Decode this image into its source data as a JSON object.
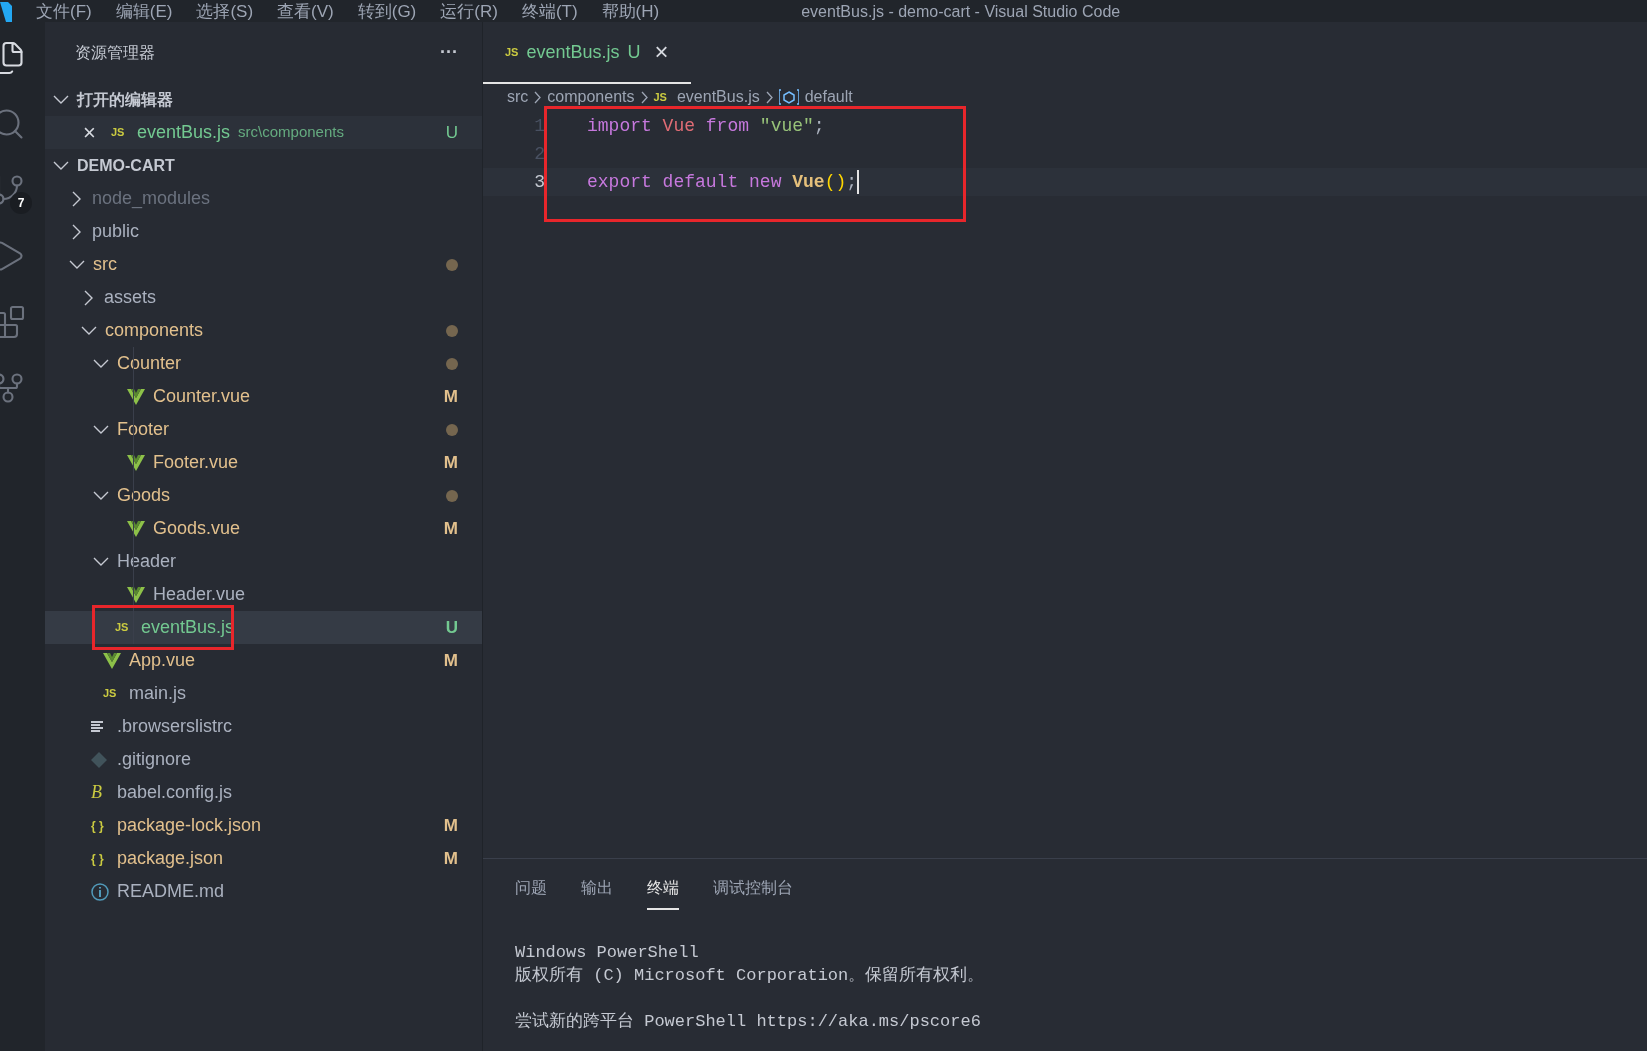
{
  "menu": [
    "文件(F)",
    "编辑(E)",
    "选择(S)",
    "查看(V)",
    "转到(G)",
    "运行(R)",
    "终端(T)",
    "帮助(H)"
  ],
  "window": {
    "title": "eventBus.js - demo-cart - Visual Studio Code"
  },
  "activity_bar": [
    {
      "kind": "files",
      "selected": true
    },
    {
      "kind": "search",
      "selected": false
    },
    {
      "kind": "source-control",
      "selected": false,
      "badge": "7"
    },
    {
      "kind": "run",
      "selected": false
    },
    {
      "kind": "extensions",
      "selected": false
    },
    {
      "kind": "graph",
      "selected": false
    }
  ],
  "sidebar": {
    "title": "资源管理器",
    "more": "···",
    "open_editors": {
      "title": "打开的编辑器",
      "expanded": true,
      "items": [
        {
          "close": "×",
          "icon_label": "JS",
          "name": "eventBus.js",
          "path": "src\\components",
          "badge": "U",
          "color": "#73c991"
        }
      ]
    },
    "folder": {
      "title": "DEMO-CART",
      "expanded": true
    },
    "tree": [
      {
        "name": "node_modules",
        "kind": "folder",
        "expanded": false,
        "color": "#6b727f",
        "selected": false
      },
      {
        "name": "public",
        "kind": "folder",
        "expanded": false,
        "color": "#aab1bf",
        "selected": false
      },
      {
        "name": "src",
        "kind": "folder",
        "expanded": true,
        "color": "#e2c08d",
        "dot": true,
        "selected": false,
        "children": [
          {
            "name": "assets",
            "kind": "folder",
            "expanded": false,
            "color": "#aab1bf",
            "selected": false
          },
          {
            "name": "components",
            "kind": "folder",
            "expanded": true,
            "color": "#e2c08d",
            "dot": true,
            "selected": false,
            "children": [
              {
                "name": "Counter",
                "kind": "folder",
                "expanded": true,
                "color": "#e2c08d",
                "dot": true,
                "selected": false,
                "children": [
                  {
                    "name": "Counter.vue",
                    "kind": "vue",
                    "color": "#e2c08d",
                    "badge": "M",
                    "selected": false
                  }
                ]
              },
              {
                "name": "Footer",
                "kind": "folder",
                "expanded": true,
                "color": "#e2c08d",
                "dot": true,
                "selected": false,
                "children": [
                  {
                    "name": "Footer.vue",
                    "kind": "vue",
                    "color": "#e2c08d",
                    "badge": "M",
                    "selected": false
                  }
                ]
              },
              {
                "name": "Goods",
                "kind": "folder",
                "expanded": true,
                "color": "#e2c08d",
                "dot": true,
                "selected": false,
                "children": [
                  {
                    "name": "Goods.vue",
                    "kind": "vue",
                    "color": "#e2c08d",
                    "badge": "M",
                    "selected": false
                  }
                ]
              },
              {
                "name": "Header",
                "kind": "folder",
                "expanded": true,
                "color": "#aab1bf",
                "selected": false,
                "children": [
                  {
                    "name": "Header.vue",
                    "kind": "vue",
                    "color": "#aab1bf",
                    "selected": false
                  }
                ]
              },
              {
                "name": "eventBus.js",
                "kind": "js",
                "icon_label": "JS",
                "color": "#73c991",
                "badge": "U",
                "selected": true
              }
            ]
          },
          {
            "name": "App.vue",
            "kind": "vue",
            "color": "#e2c08d",
            "badge": "M",
            "selected": false
          },
          {
            "name": "main.js",
            "kind": "js",
            "icon_label": "JS",
            "color": "#aab1bf",
            "selected": false
          }
        ]
      },
      {
        "name": ".browserslistrc",
        "kind": "lines",
        "color": "#aab1bf",
        "selected": false
      },
      {
        "name": ".gitignore",
        "kind": "git",
        "color": "#aab1bf",
        "selected": false
      },
      {
        "name": "babel.config.js",
        "kind": "babel",
        "icon_label": "B",
        "color": "#aab1bf",
        "selected": false
      },
      {
        "name": "package-lock.json",
        "kind": "json",
        "icon_label": "{ }",
        "color": "#e2c08d",
        "badge": "M",
        "selected": false
      },
      {
        "name": "package.json",
        "kind": "json",
        "icon_label": "{ }",
        "color": "#e2c08d",
        "badge": "M",
        "selected": false
      },
      {
        "name": "README.md",
        "kind": "info",
        "color": "#aab1bf",
        "selected": false
      }
    ]
  },
  "editor": {
    "tabs": [
      {
        "icon_label": "JS",
        "name": "eventBus.js",
        "badge": "U",
        "close": "×",
        "selected": true
      }
    ],
    "breadcrumb": [
      {
        "kind": "folder",
        "text": "src"
      },
      {
        "kind": "folder",
        "text": "components"
      },
      {
        "kind": "js",
        "icon_label": "JS",
        "text": "eventBus.js"
      },
      {
        "kind": "symbol",
        "text": "default"
      }
    ],
    "lines": [
      {
        "number": "1",
        "current": false,
        "words": [
          [
            {
              "text": "import",
              "kind": "keyword"
            }
          ],
          [
            {
              "text": "Vue",
              "kind": "variable"
            }
          ],
          [
            {
              "text": "from",
              "kind": "keyword"
            }
          ],
          [
            {
              "text": "\"vue\"",
              "kind": "string"
            },
            {
              "text": ";",
              "kind": "plain"
            }
          ]
        ]
      },
      {
        "number": "2",
        "current": false
      },
      {
        "number": "3",
        "current": true,
        "words": [
          [
            {
              "text": "export",
              "kind": "keyword"
            }
          ],
          [
            {
              "text": "default",
              "kind": "keyword"
            }
          ],
          [
            {
              "text": "new",
              "kind": "keyword"
            }
          ],
          [
            {
              "text": "Vue",
              "kind": "class"
            },
            {
              "text": "()",
              "kind": "paren"
            },
            {
              "text": ";",
              "kind": "plain"
            }
          ]
        ]
      }
    ]
  },
  "panel": {
    "tabs": [
      {
        "label": "问题",
        "selected": false
      },
      {
        "label": "输出",
        "selected": false
      },
      {
        "label": "终端",
        "selected": true
      },
      {
        "label": "调试控制台",
        "selected": false
      }
    ],
    "terminal": [
      [
        "Windows PowerShell",
        "版权所有 (C) Microsoft Corporation。保留所有权利。"
      ],
      [
        "尝试新的跨平台 PowerShell https://aka.ms/pscore6"
      ]
    ]
  }
}
